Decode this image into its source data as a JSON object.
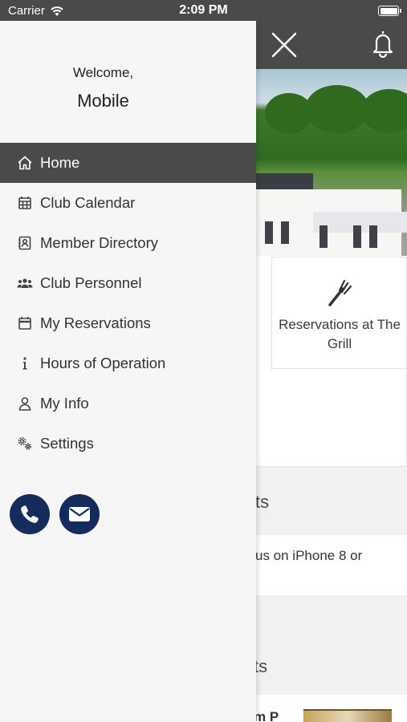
{
  "status_bar": {
    "carrier": "Carrier",
    "time": "2:09 PM"
  },
  "drawer": {
    "welcome": "Welcome,",
    "user_name": "Mobile",
    "menu": [
      {
        "label": "Home",
        "icon": "home-icon",
        "active": true
      },
      {
        "label": "Club Calendar",
        "icon": "calendar-grid-icon"
      },
      {
        "label": "Member Directory",
        "icon": "contact-card-icon"
      },
      {
        "label": "Club Personnel",
        "icon": "group-icon"
      },
      {
        "label": "My Reservations",
        "icon": "calendar-icon"
      },
      {
        "label": "Hours of Operation",
        "icon": "info-icon"
      },
      {
        "label": "My Info",
        "icon": "user-icon"
      },
      {
        "label": "Settings",
        "icon": "gears-icon"
      }
    ],
    "contact": {
      "phone_icon": "phone-icon",
      "email_icon": "envelope-icon"
    }
  },
  "main": {
    "tile_grill_label": "Reservations at The Grill",
    "section_1_fragment": "ts",
    "news_fragment": "us on iPhone 8 or",
    "section_2_fragment": "ts",
    "item_fragment": "m P"
  },
  "colors": {
    "header": "#4a4a4a",
    "drawer_bg": "#f6f6f6",
    "active_item": "#4a4a4a",
    "contact_button": "#142b5c"
  }
}
